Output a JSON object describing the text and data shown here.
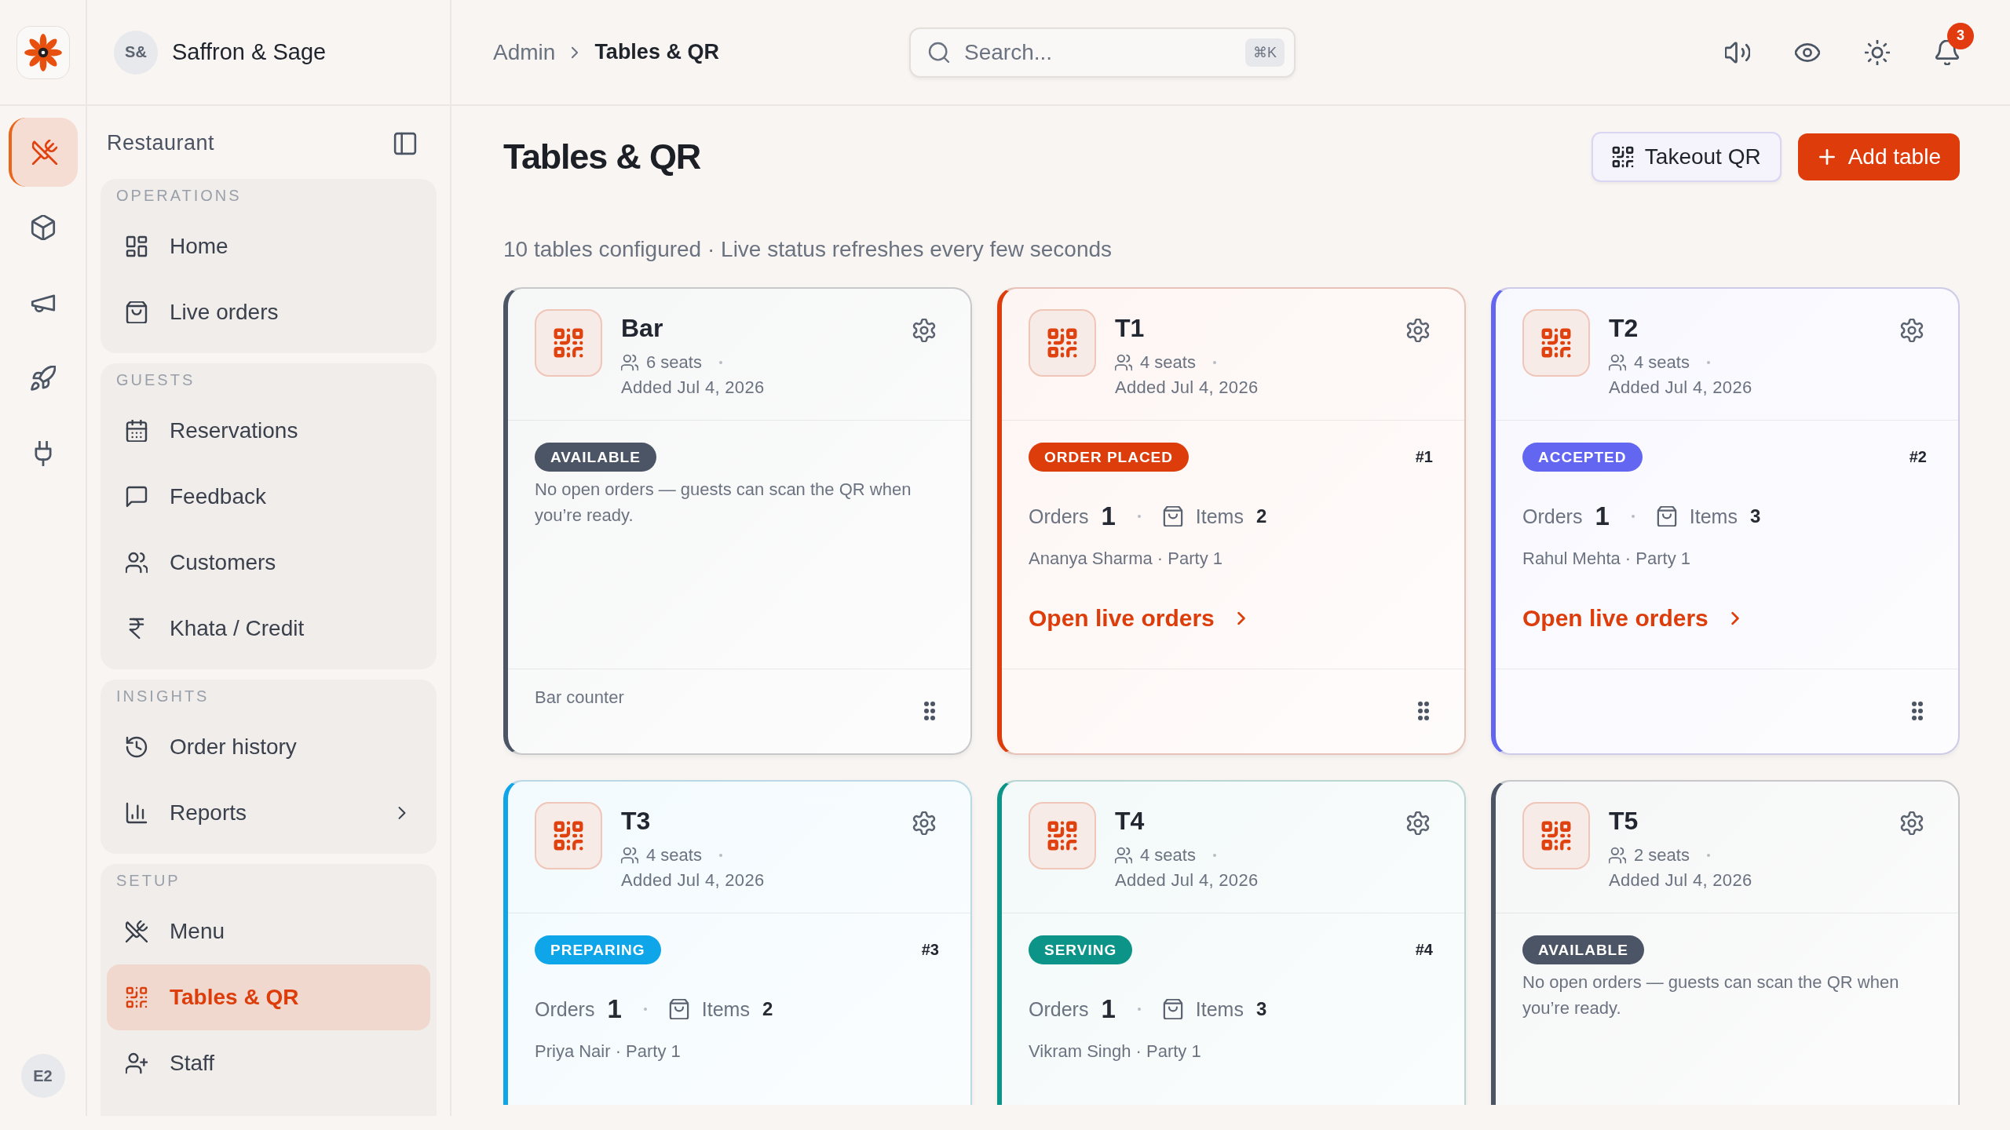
{
  "rail": {
    "items": [
      {
        "selected": true
      },
      {
        "selected": false
      },
      {
        "selected": false
      },
      {
        "selected": false
      },
      {
        "selected": false
      }
    ],
    "user_avatar": "E2"
  },
  "brand": {
    "initials": "S&",
    "name": "Saffron & Sage"
  },
  "breadcrumb": [
    "Admin",
    "Tables & QR"
  ],
  "search": {
    "placeholder": "Search...",
    "shortcut": "⌘K"
  },
  "notifications": {
    "count": "3"
  },
  "sidebar": {
    "title": "Restaurant",
    "groups": [
      {
        "label": "OPERATIONS",
        "items": [
          {
            "label": "Home",
            "kind": "link",
            "selected": false
          },
          {
            "label": "Live orders",
            "kind": "link",
            "selected": false
          }
        ]
      },
      {
        "label": "GUESTS",
        "items": [
          {
            "label": "Reservations",
            "kind": "link",
            "selected": false
          },
          {
            "label": "Feedback",
            "kind": "link",
            "selected": false
          },
          {
            "label": "Customers",
            "kind": "link",
            "selected": false
          },
          {
            "label": "Khata / Credit",
            "kind": "link",
            "selected": false
          }
        ]
      },
      {
        "label": "INSIGHTS",
        "items": [
          {
            "label": "Order history",
            "kind": "link",
            "selected": false
          },
          {
            "label": "Reports",
            "kind": "submenu",
            "selected": false
          }
        ]
      },
      {
        "label": "SETUP",
        "items": [
          {
            "label": "Menu",
            "kind": "link",
            "selected": false
          },
          {
            "label": "Tables & QR",
            "kind": "link",
            "selected": true
          },
          {
            "label": "Staff",
            "kind": "link",
            "selected": false
          }
        ]
      }
    ]
  },
  "page": {
    "title": "Tables & QR",
    "buttons": [
      {
        "label": "Takeout QR",
        "kind": "secondary"
      },
      {
        "label": "Add table",
        "kind": "primary"
      }
    ],
    "subtitle": "10 tables configured · Live status refreshes every few seconds"
  },
  "tables": [
    {
      "name": "Bar",
      "seats": "6 seats",
      "added": "Added Jul 4, 2026",
      "kind": "available",
      "status": "AVAILABLE",
      "color": "#4b5565",
      "note": "No open orders — guests can scan the QR when you’re ready.",
      "location": "Bar counter"
    },
    {
      "name": "T1",
      "seats": "4 seats",
      "added": "Added Jul 4, 2026",
      "kind": "active",
      "status": "ORDER PLACED",
      "color": "#dc3d0a",
      "number": "#1",
      "orders_label": "Orders",
      "orders": "1",
      "items_label": "Items",
      "items": "2",
      "guest": "Ananya Sharma · Party 1",
      "link": "Open live orders"
    },
    {
      "name": "T2",
      "seats": "4 seats",
      "added": "Added Jul 4, 2026",
      "kind": "active",
      "status": "ACCEPTED",
      "color": "#6366f1",
      "number": "#2",
      "orders_label": "Orders",
      "orders": "1",
      "items_label": "Items",
      "items": "3",
      "guest": "Rahul Mehta · Party 1",
      "link": "Open live orders"
    },
    {
      "name": "T3",
      "seats": "4 seats",
      "added": "Added Jul 4, 2026",
      "kind": "active",
      "status": "PREPARING",
      "color": "#0ea5e9",
      "number": "#3",
      "orders_label": "Orders",
      "orders": "1",
      "items_label": "Items",
      "items": "2",
      "guest": "Priya Nair · Party 1"
    },
    {
      "name": "T4",
      "seats": "4 seats",
      "added": "Added Jul 4, 2026",
      "kind": "active",
      "status": "SERVING",
      "color": "#0d9488",
      "number": "#4",
      "orders_label": "Orders",
      "orders": "1",
      "items_label": "Items",
      "items": "3",
      "guest": "Vikram Singh · Party 1"
    },
    {
      "name": "T5",
      "seats": "2 seats",
      "added": "Added Jul 4, 2026",
      "kind": "available",
      "status": "AVAILABLE",
      "color": "#4b5565",
      "note": "No open orders — guests can scan the QR when you’re ready."
    }
  ]
}
